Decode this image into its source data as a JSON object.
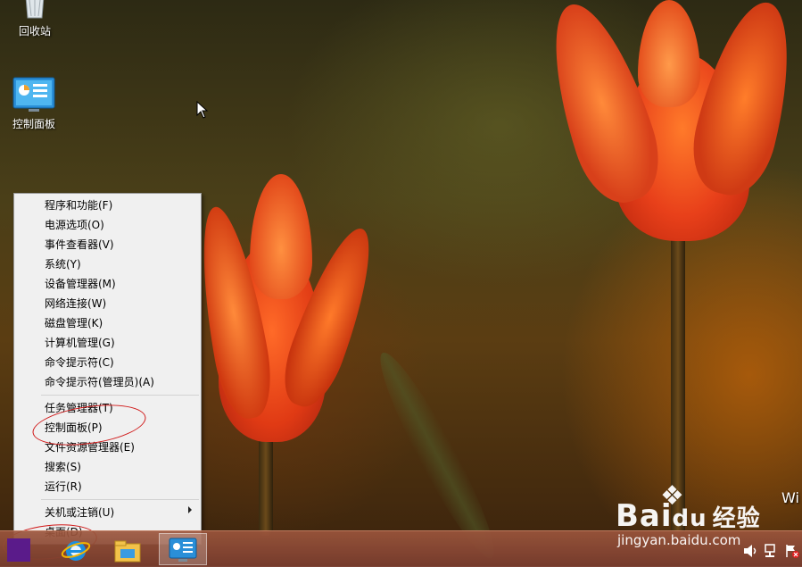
{
  "desktop": {
    "icons": [
      {
        "label": "回收站",
        "icon": "recycle-bin-icon"
      },
      {
        "label": "控制面板",
        "icon": "control-panel-icon"
      }
    ]
  },
  "context_menu": {
    "items": [
      {
        "label": "程序和功能(F)"
      },
      {
        "label": "电源选项(O)"
      },
      {
        "label": "事件查看器(V)"
      },
      {
        "label": "系统(Y)"
      },
      {
        "label": "设备管理器(M)"
      },
      {
        "label": "网络连接(W)"
      },
      {
        "label": "磁盘管理(K)"
      },
      {
        "label": "计算机管理(G)"
      },
      {
        "label": "命令提示符(C)"
      },
      {
        "label": "命令提示符(管理员)(A)"
      },
      {
        "label": "任务管理器(T)"
      },
      {
        "label": "控制面板(P)"
      },
      {
        "label": "文件资源管理器(E)"
      },
      {
        "label": "搜索(S)"
      },
      {
        "label": "运行(R)"
      },
      {
        "label": "关机或注销(U)"
      },
      {
        "label": "桌面(D)"
      }
    ]
  },
  "taskbar": {
    "buttons": [
      {
        "icon": "start-icon"
      },
      {
        "icon": "internet-explorer-icon"
      },
      {
        "icon": "file-explorer-icon"
      },
      {
        "icon": "control-panel-icon",
        "active": true
      }
    ],
    "tray": [
      "speaker-icon",
      "network-icon",
      "action-center-icon"
    ]
  },
  "watermark": {
    "brand_a": "Bai",
    "brand_b": "du",
    "brand_cn": "经验",
    "url": "jingyan.baidu.com"
  },
  "activation_text": "Wi",
  "colors": {
    "annotation": "#d01818",
    "menu_bg": "#f0f0f0",
    "taskbar": "#9b553c"
  }
}
